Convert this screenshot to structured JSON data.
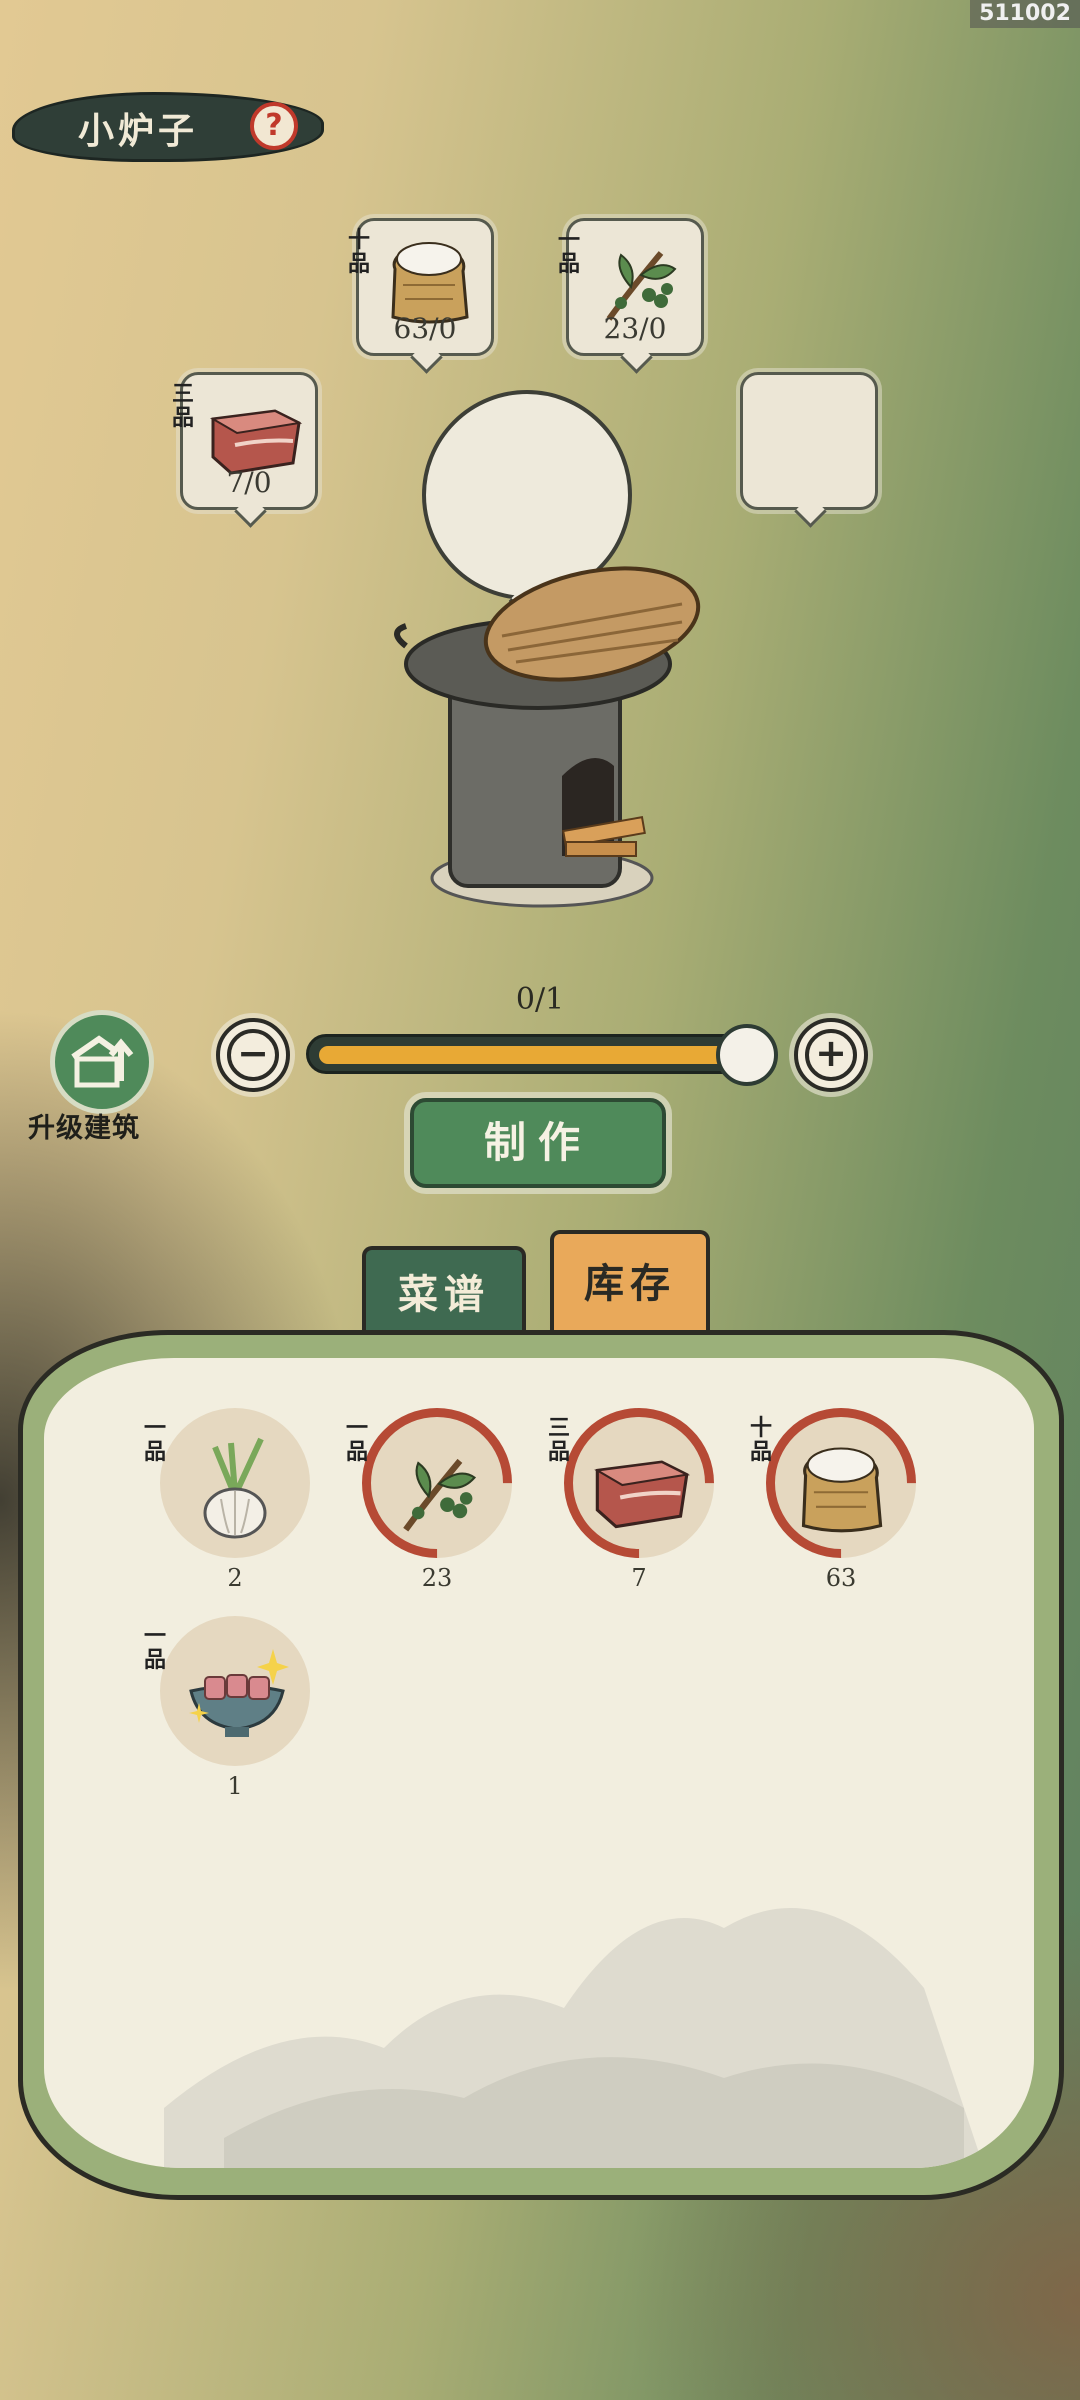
{
  "build_id": "511002",
  "title": "小炉子",
  "help_icon": "question-icon",
  "slots": [
    {
      "grade": "十品",
      "item": "flour-sack",
      "count": "63/0"
    },
    {
      "grade": "一品",
      "item": "pepper-branch",
      "count": "23/0"
    },
    {
      "grade": "三品",
      "item": "pork-belly",
      "count": "7/0"
    },
    {
      "grade": "",
      "item": "",
      "count": ""
    }
  ],
  "stove": {
    "icon": "clay-stove-icon"
  },
  "upgrade": {
    "label": "升级建筑",
    "icon": "upgrade-building-icon"
  },
  "quantity": {
    "value": "0/1",
    "fill_fraction": 1.0
  },
  "make_label": "制作",
  "tabs": {
    "recipes": "菜谱",
    "inventory": "库存",
    "active": "inventory"
  },
  "inventory": [
    {
      "grade": "一品",
      "item": "garlic",
      "qty": "2",
      "ring": false
    },
    {
      "grade": "一品",
      "item": "pepper-branch",
      "qty": "23",
      "ring": true
    },
    {
      "grade": "三品",
      "item": "pork-belly",
      "qty": "7",
      "ring": true
    },
    {
      "grade": "十品",
      "item": "flour-sack",
      "qty": "63",
      "ring": true
    },
    {
      "grade": "一品",
      "item": "braised-pork-dish",
      "qty": "1",
      "ring": false
    }
  ],
  "colors": {
    "accent_green": "#4f8a5a",
    "slider_fill": "#e8a935",
    "ring_red": "#b64a35",
    "tab_orange": "#e9a95a"
  }
}
